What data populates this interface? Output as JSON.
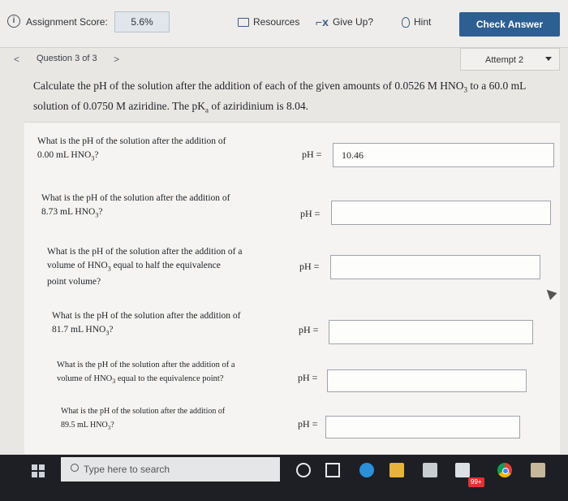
{
  "header": {
    "score_label": "Assignment Score:",
    "score_value": "5.6%",
    "resources": "Resources",
    "give_up": "Give Up?",
    "hint": "Hint",
    "check_answer": "Check Answer"
  },
  "nav": {
    "question": "Question 3 of 3",
    "attempt": "Attempt 2"
  },
  "problem": {
    "lead": "Calculate the pH of the solution after the addition of each of the given amounts of 0.0526 M HNO",
    "lead_sub": "3",
    "mid": " to a 60.0 mL solution of 0.0750 M aziridine. The pK",
    "mid_sub": "a",
    "tail": " of aziridinium is 8.04."
  },
  "parts": [
    {
      "line1": "What is the pH of the solution after the addition of",
      "line2": "0.00 mL HNO",
      "line2_sub": "3",
      "line2_end": "?",
      "label": "pH =",
      "value": "10.46"
    },
    {
      "line1": "What is the pH of the solution after the addition of",
      "line2": "8.73 mL HNO",
      "line2_sub": "3",
      "line2_end": "?",
      "label": "pH =",
      "value": ""
    },
    {
      "line1": "What is the pH of the solution after the addition of a",
      "line2": "volume of HNO",
      "line2_sub": "3",
      "line2_end": " equal to half the equivalence",
      "line3": "point volume?",
      "label": "pH =",
      "value": ""
    },
    {
      "line1": "What is the pH of the solution after the addition of",
      "line2": "81.7 mL HNO",
      "line2_sub": "3",
      "line2_end": "?",
      "label": "pH =",
      "value": ""
    },
    {
      "line1": "What is the pH of the solution after the addition of a",
      "line2": "volume of HNO",
      "line2_sub": "3",
      "line2_end": " equal to the equivalence point?",
      "label": "pH =",
      "value": ""
    },
    {
      "line1": "What is the pH of the solution after the addition of",
      "line2": "89.5 mL HNO",
      "line2_sub": "3",
      "line2_end": "?",
      "label": "pH =",
      "value": ""
    }
  ],
  "taskbar": {
    "search_placeholder": "Type here to search",
    "mail_badge": "99+"
  }
}
